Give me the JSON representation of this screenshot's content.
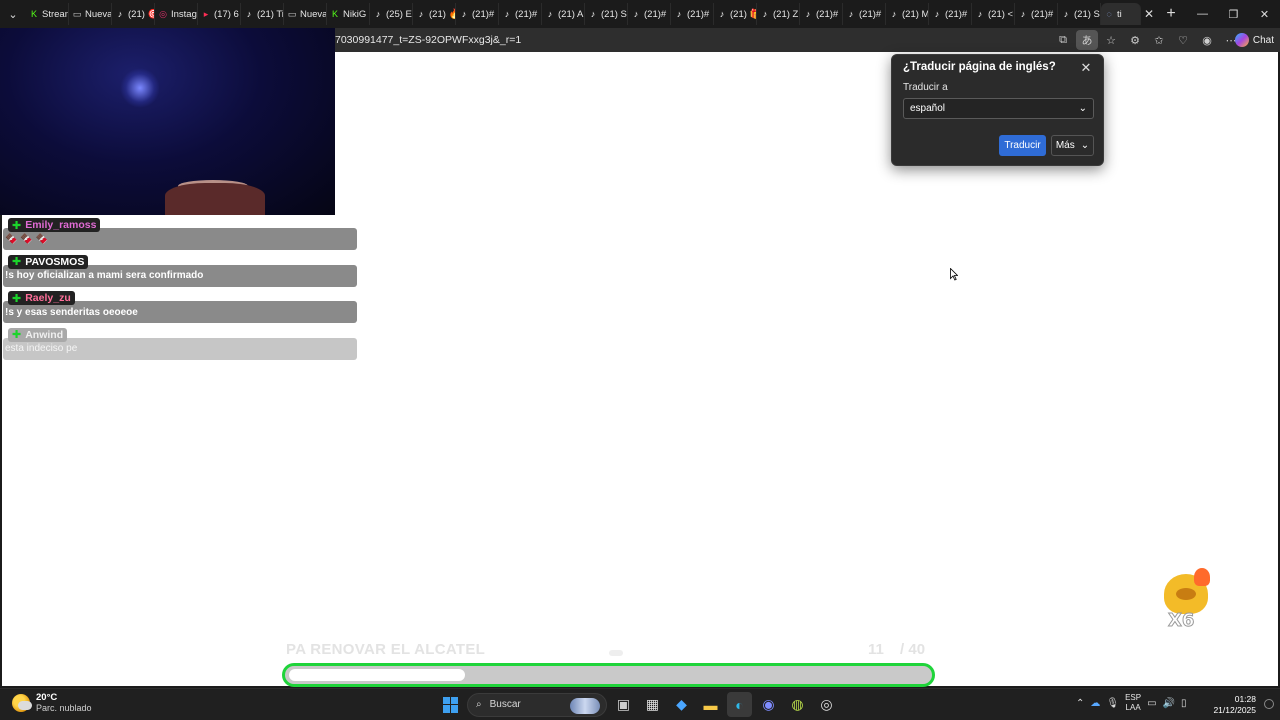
{
  "tabs": [
    {
      "icon": "kick-icon",
      "icon_char": "K",
      "color": "#53fc18",
      "label": "Stream"
    },
    {
      "icon": "page-icon",
      "icon_char": "▭",
      "color": "#cccccc",
      "label": "Nueva"
    },
    {
      "icon": "tiktok-icon",
      "icon_char": "♪",
      "color": "#ffffff",
      "label": "(21) 🎯"
    },
    {
      "icon": "instagram-icon",
      "icon_char": "◎",
      "color": "#e1306c",
      "label": "Instagr"
    },
    {
      "icon": "youtube-icon",
      "icon_char": "▸",
      "color": "#ff2d55",
      "label": "(17) 6"
    },
    {
      "icon": "tiktok-icon",
      "icon_char": "♪",
      "color": "#ffffff",
      "label": "(21) Tik"
    },
    {
      "icon": "page-icon",
      "icon_char": "▭",
      "color": "#cccccc",
      "label": "Nueva"
    },
    {
      "icon": "kick-icon",
      "icon_char": "K",
      "color": "#53fc18",
      "label": "NikiG"
    },
    {
      "icon": "tiktok-icon",
      "icon_char": "♪",
      "color": "#ffffff",
      "label": "(25) E"
    },
    {
      "icon": "tiktok-icon",
      "icon_char": "♪",
      "color": "#ffffff",
      "label": "(21) 🔥"
    },
    {
      "icon": "tiktok-icon",
      "icon_char": "♪",
      "color": "#ffffff",
      "label": "(21)#"
    },
    {
      "icon": "tiktok-icon",
      "icon_char": "♪",
      "color": "#ffffff",
      "label": "(21)#"
    },
    {
      "icon": "tiktok-icon",
      "icon_char": "♪",
      "color": "#ffffff",
      "label": "(21) A"
    },
    {
      "icon": "tiktok-icon",
      "icon_char": "♪",
      "color": "#ffffff",
      "label": "(21) S"
    },
    {
      "icon": "tiktok-icon",
      "icon_char": "♪",
      "color": "#ffffff",
      "label": "(21)#"
    },
    {
      "icon": "tiktok-icon",
      "icon_char": "♪",
      "color": "#ffffff",
      "label": "(21)#"
    },
    {
      "icon": "tiktok-icon",
      "icon_char": "♪",
      "color": "#ffffff",
      "label": "(21) 🎁"
    },
    {
      "icon": "tiktok-icon",
      "icon_char": "♪",
      "color": "#ffffff",
      "label": "(21) Z"
    },
    {
      "icon": "tiktok-icon",
      "icon_char": "♪",
      "color": "#ffffff",
      "label": "(21)#"
    },
    {
      "icon": "tiktok-icon",
      "icon_char": "♪",
      "color": "#ffffff",
      "label": "(21)#"
    },
    {
      "icon": "tiktok-icon",
      "icon_char": "♪",
      "color": "#ffffff",
      "label": "(21) M"
    },
    {
      "icon": "tiktok-icon",
      "icon_char": "♪",
      "color": "#ffffff",
      "label": "(21)#"
    },
    {
      "icon": "tiktok-icon",
      "icon_char": "♪",
      "color": "#ffffff",
      "label": "(21) <"
    },
    {
      "icon": "tiktok-icon",
      "icon_char": "♪",
      "color": "#ffffff",
      "label": "(21)#"
    },
    {
      "icon": "tiktok-icon",
      "icon_char": "♪",
      "color": "#ffffff",
      "label": "(21) S"
    }
  ],
  "active_tab": {
    "icon": "loading-icon",
    "label": "ti"
  },
  "url": "7030991477_t=ZS-92OPWFxxg3j&_r=1",
  "toolbar": {
    "chat_label": "Chat"
  },
  "chat": [
    {
      "user": "Emily_ramoss",
      "user_color": "#e06bd4",
      "message": "🍫 🍫 🍫",
      "faded": false
    },
    {
      "user": "PAVOSMOS",
      "user_color": "#ffffff",
      "message": "!s hoy oficializan a mami sera confirmado",
      "faded": false
    },
    {
      "user": "Raely_zu",
      "user_color": "#ff6f9a",
      "message": "!s y esas senderitas oeoeoe",
      "faded": false
    },
    {
      "user": "Anwind",
      "user_color": "#efefef",
      "message": "esta indeciso pe",
      "faded": true
    }
  ],
  "translate_popup": {
    "title": "¿Traducir página de inglés?",
    "label": "Traducir a",
    "language": "español",
    "primary_button": "Traducir",
    "more_button": "Más"
  },
  "goal": {
    "label": "PA RENOVAR EL ALCATEL",
    "current": "11",
    "total": "/ 40",
    "progress": 0.275
  },
  "sticker": {
    "multiplier": "X6"
  },
  "taskbar": {
    "temperature": "20°C",
    "condition": "Parc. nublado",
    "search_placeholder": "Buscar",
    "lang_line1": "ESP",
    "lang_line2": "LAA",
    "time": "01:28",
    "date": "21/12/2025"
  }
}
